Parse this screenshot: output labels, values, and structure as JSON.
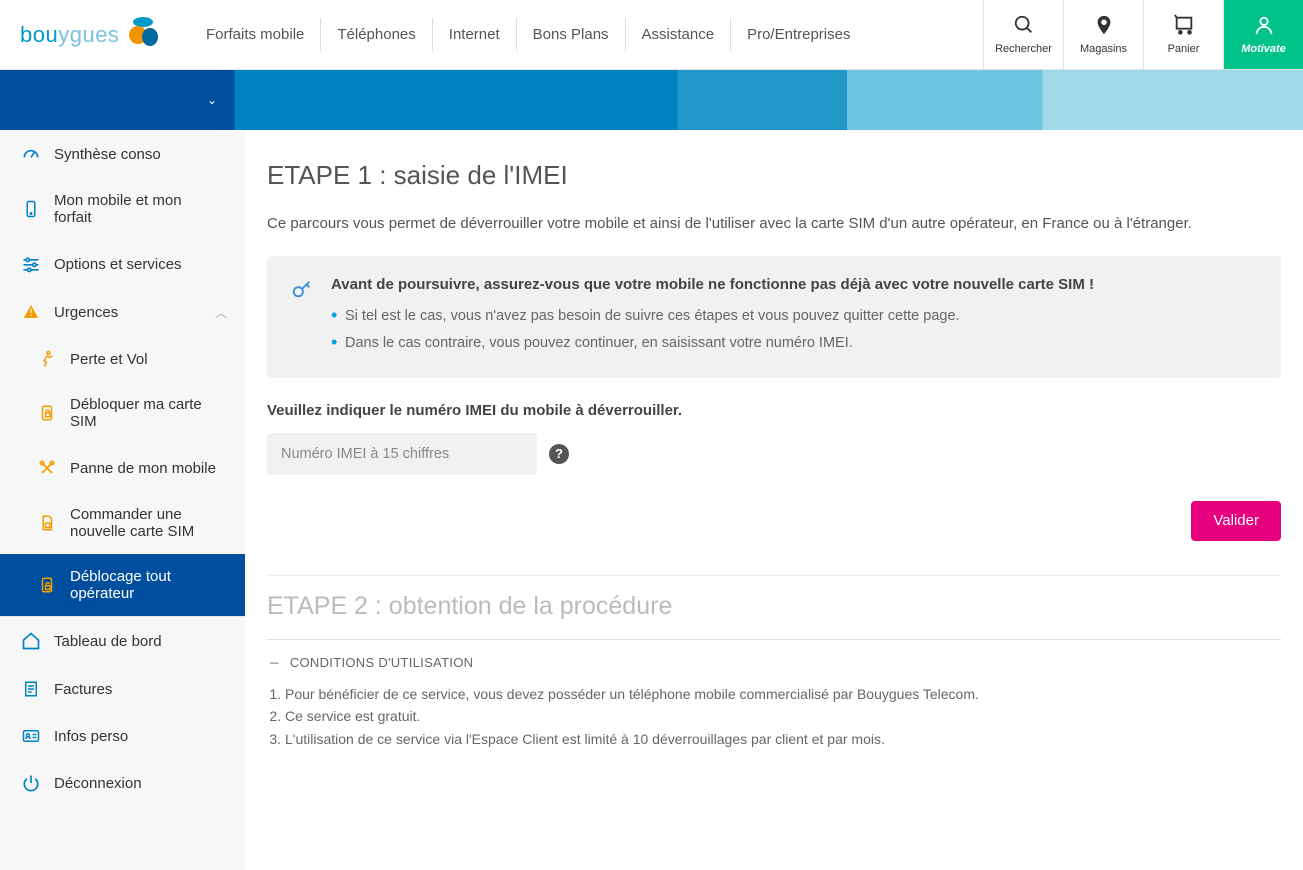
{
  "header": {
    "nav": [
      "Forfaits mobile",
      "Téléphones",
      "Internet",
      "Bons Plans",
      "Assistance",
      "Pro/Entreprises"
    ],
    "actions": {
      "search": "Rechercher",
      "stores": "Magasins",
      "cart": "Panier",
      "account": "Motivate"
    }
  },
  "sidebar": {
    "summary": "Synthèse conso",
    "mobile_plan": "Mon mobile et mon forfait",
    "options": "Options et services",
    "urgences": "Urgences",
    "loss_theft": "Perte et Vol",
    "unblock_sim": "Débloquer ma carte SIM",
    "breakdown": "Panne de mon mobile",
    "order_sim": "Commander une nouvelle carte SIM",
    "unlock_all": "Déblocage tout opérateur",
    "dashboard": "Tableau de bord",
    "invoices": "Factures",
    "personal": "Infos perso",
    "logout": "Déconnexion"
  },
  "step1": {
    "title": "ETAPE 1 : saisie de l'IMEI",
    "intro": "Ce parcours vous permet de déverrouiller votre mobile et ainsi de l'utiliser avec la carte SIM d'un autre opérateur, en France ou à l'étranger.",
    "warn_title": "Avant de poursuivre, assurez-vous que votre mobile ne fonctionne pas déjà avec votre nouvelle carte SIM !",
    "warn_b1": "Si tel est le cas, vous n'avez pas besoin de suivre ces étapes et vous pouvez quitter cette page.",
    "warn_b2": "Dans le cas contraire, vous pouvez continuer, en saisissant votre numéro IMEI.",
    "form_label": "Veuillez indiquer le numéro IMEI du mobile à déverrouiller.",
    "placeholder": "Numéro IMEI à 15 chiffres",
    "validate": "Valider"
  },
  "step2": {
    "title": "ETAPE 2 : obtention de la procédure"
  },
  "conditions": {
    "heading": "CONDITIONS D'UTILISATION",
    "c1": "Pour bénéficier de ce service, vous devez posséder un téléphone mobile commercialisé par Bouygues Telecom.",
    "c2": "Ce service est gratuit.",
    "c3": "L'utilisation de ce service via l'Espace Client est limité à 10 déverrouillages par client et par mois."
  }
}
